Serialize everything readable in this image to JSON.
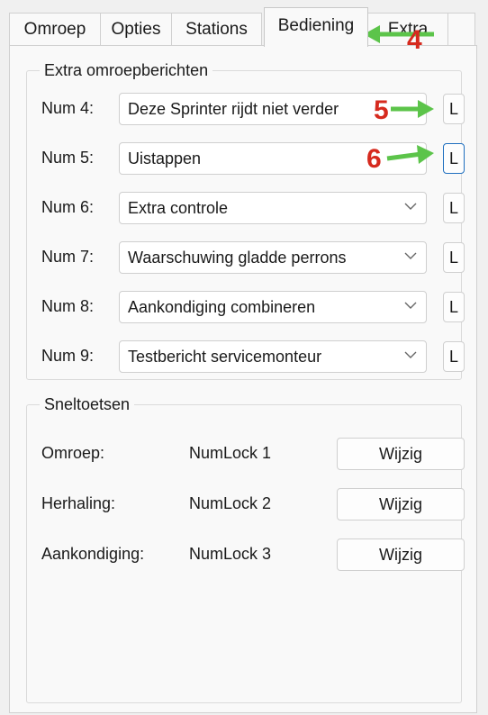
{
  "tabs": [
    {
      "label": "Omroep"
    },
    {
      "label": "Opties"
    },
    {
      "label": "Stations"
    },
    {
      "label": "Bediening"
    },
    {
      "label": "Extra"
    }
  ],
  "extra_group": {
    "title": "Extra omroepberichten",
    "rows": [
      {
        "label": "Num 4:",
        "value": "Deze Sprinter rijdt niet verder",
        "button": "L"
      },
      {
        "label": "Num 5:",
        "value": "Uistappen",
        "button": "L"
      },
      {
        "label": "Num 6:",
        "value": "Extra controle",
        "button": "L"
      },
      {
        "label": "Num 7:",
        "value": "Waarschuwing gladde perrons",
        "button": "L"
      },
      {
        "label": "Num 8:",
        "value": "Aankondiging combineren",
        "button": "L"
      },
      {
        "label": "Num 9:",
        "value": "Testbericht servicemonteur",
        "button": "L"
      }
    ]
  },
  "shortcuts_group": {
    "title": "Sneltoetsen",
    "rows": [
      {
        "label": "Omroep:",
        "key": "NumLock 1",
        "button": "Wijzig"
      },
      {
        "label": "Herhaling:",
        "key": "NumLock 2",
        "button": "Wijzig"
      },
      {
        "label": "Aankondiging:",
        "key": "NumLock 3",
        "button": "Wijzig"
      }
    ]
  },
  "annotations": {
    "tab_marker": "4",
    "row4_marker": "5",
    "row5_marker": "6",
    "arrow_color": "#5cc44a",
    "number_color": "#d62a1e"
  }
}
